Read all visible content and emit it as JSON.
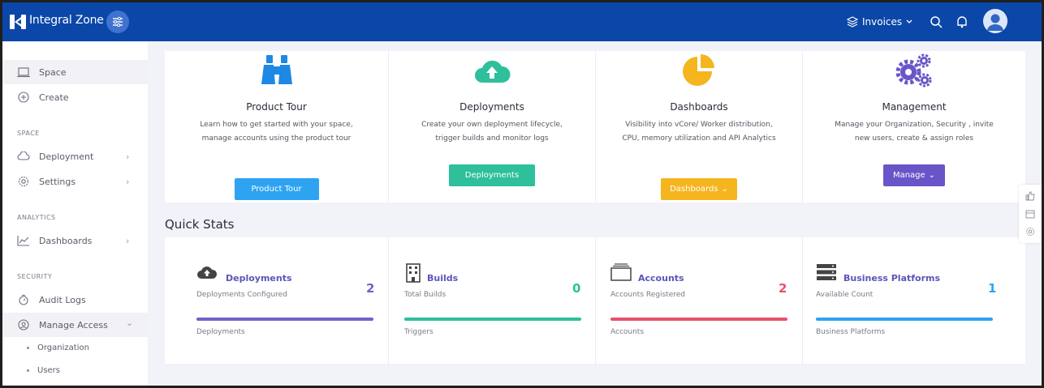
{
  "header": {
    "brand": "Integral Zone",
    "workspace": "Invoices",
    "icons": [
      "layers-icon",
      "search-icon",
      "bell-icon",
      "avatar"
    ]
  },
  "sidebar": {
    "top_items": [
      {
        "label": "Space",
        "icon": "space-icon",
        "active": true
      },
      {
        "label": "Create",
        "icon": "plus-circle-icon"
      }
    ],
    "sections": [
      {
        "title": "SPACE",
        "items": [
          {
            "label": "Deployment",
            "icon": "cloud-icon",
            "chevron": "›"
          },
          {
            "label": "Settings",
            "icon": "gear-icon",
            "chevron": "›"
          }
        ]
      },
      {
        "title": "ANALYTICS",
        "items": [
          {
            "label": "Dashboards",
            "icon": "chart-icon",
            "chevron": "›"
          }
        ]
      },
      {
        "title": "SECURITY",
        "items": [
          {
            "label": "Audit Logs",
            "icon": "timer-icon"
          },
          {
            "label": "Manage Access",
            "icon": "access-icon",
            "chevron": "⌄",
            "active": true
          }
        ]
      }
    ],
    "sub_items": [
      "Organization",
      "Users"
    ]
  },
  "cards": [
    {
      "title": "Product Tour",
      "desc": "Learn how to get started with your space, manage accounts using the product tour",
      "button": "Product Tour",
      "color": "#2ea3f2",
      "icon": "binoculars-icon"
    },
    {
      "title": "Deployments",
      "desc": "Create your own deployment lifecycle, trigger builds and monitor logs",
      "button": "Deployments",
      "color": "#2ebf9b",
      "icon": "cloud-upload-icon"
    },
    {
      "title": "Dashboards",
      "desc": "Visibility into vCore/ Worker distribution, CPU, memory utilization and API Analytics",
      "button": "Dashboards",
      "button_caret": "⌄",
      "color": "#f5b51e",
      "icon": "pie-chart-icon"
    },
    {
      "title": "Management",
      "desc": "Manage your Organization, Security , invite new users, create & assign roles",
      "button": "Manage",
      "button_caret": "⌄",
      "color": "#6a55c8",
      "icon": "gears-icon"
    }
  ],
  "quick_stats": {
    "title": "Quick Stats",
    "items": [
      {
        "title": "Deployments",
        "subtitle": "Deployments Configured",
        "value": "2",
        "footer": "Deployments",
        "color": "#6f63c8",
        "icon": "cloud-icon"
      },
      {
        "title": "Builds",
        "subtitle": "Total Builds",
        "value": "0",
        "footer": "Triggers",
        "color": "#2ebf9b",
        "icon": "building-icon"
      },
      {
        "title": "Accounts",
        "subtitle": "Accounts Registered",
        "value": "2",
        "footer": "Accounts",
        "color": "#e8516a",
        "icon": "folders-icon"
      },
      {
        "title": "Business Platforms",
        "subtitle": "Available Count",
        "value": "1",
        "footer": "Business Platforms",
        "color": "#2ea3f2",
        "icon": "server-icon"
      }
    ]
  },
  "float_toolbar": [
    "thumbs-up-icon",
    "calendar-icon",
    "settings-icon"
  ]
}
